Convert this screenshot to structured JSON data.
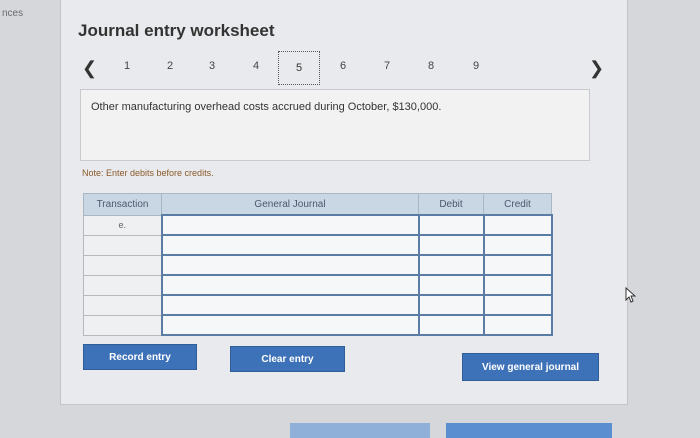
{
  "corner_text": "nces",
  "title": "Journal entry worksheet",
  "nav": {
    "prev_icon": "chevron-left-icon",
    "next_icon": "chevron-right-icon",
    "pages": [
      "1",
      "2",
      "3",
      "4",
      "5",
      "6",
      "7",
      "8",
      "9"
    ],
    "current_page": "5"
  },
  "prompt": "Other manufacturing overhead costs accrued during October, $130,000.",
  "note": "Note: Enter debits before credits.",
  "table": {
    "headers": [
      "Transaction",
      "General Journal",
      "Debit",
      "Credit"
    ],
    "rows": [
      [
        "e.",
        "",
        "",
        ""
      ],
      [
        "",
        "",
        "",
        ""
      ],
      [
        "",
        "",
        "",
        ""
      ],
      [
        "",
        "",
        "",
        ""
      ],
      [
        "",
        "",
        "",
        ""
      ],
      [
        "",
        "",
        "",
        ""
      ]
    ]
  },
  "buttons": {
    "record": "Record entry",
    "clear": "Clear entry",
    "view": "View general journal"
  },
  "colors": {
    "button": "#3e72b8",
    "header": "#c9d6e4",
    "input_border": "#5a7ca5"
  }
}
